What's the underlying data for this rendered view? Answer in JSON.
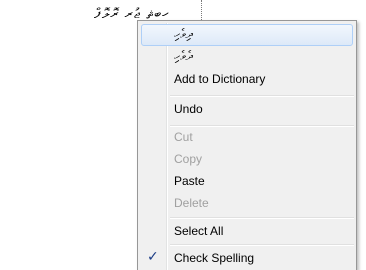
{
  "document": {
    "text_before": "ޖުރ ރޮލޮފް ",
    "misspelled_word": "ހބޘ"
  },
  "context_menu": {
    "suggestions": [
      "ދިވެހި",
      "ދެވެހި"
    ],
    "add_to_dictionary": "Add to Dictionary",
    "undo": "Undo",
    "cut": "Cut",
    "copy": "Copy",
    "paste": "Paste",
    "delete": "Delete",
    "select_all": "Select All",
    "check_spelling": "Check Spelling",
    "check_mark": "✓"
  }
}
